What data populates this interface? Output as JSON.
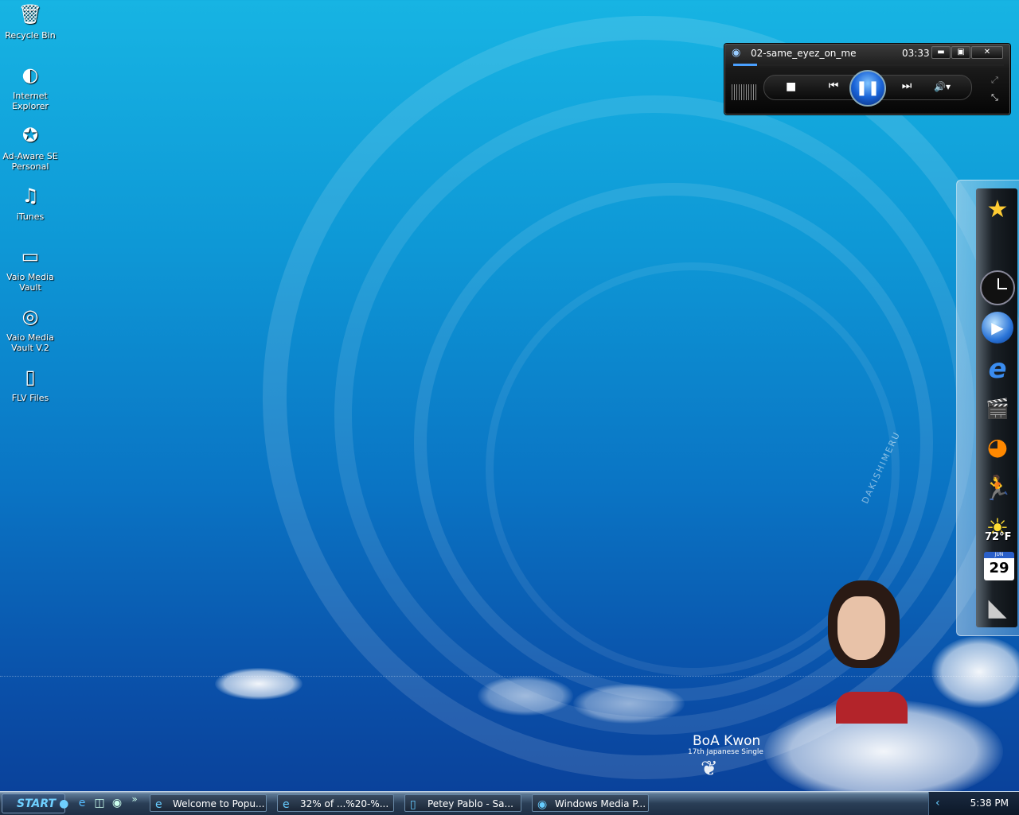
{
  "desktop_icons": [
    {
      "label": "Recycle Bin",
      "icon": "recycle-bin-icon",
      "glyph": "🗑"
    },
    {
      "label": "Internet\nExplorer",
      "icon": "internet-explorer-icon",
      "glyph": "◐"
    },
    {
      "label": "Ad-Aware SE\nPersonal",
      "icon": "ad-aware-icon",
      "glyph": "✪"
    },
    {
      "label": "iTunes",
      "icon": "itunes-icon",
      "glyph": "♫"
    },
    {
      "label": "Vaio Media\nVault",
      "icon": "vaio-media-vault-icon",
      "glyph": "▭"
    },
    {
      "label": "Vaio Media\nVault V.2",
      "icon": "vaio-media-vault-v2-icon",
      "glyph": "◎"
    },
    {
      "label": "FLV Files",
      "icon": "flv-files-icon",
      "glyph": "▯"
    }
  ],
  "media_player": {
    "track": "02-same_eyez_on_me",
    "time": "03:33",
    "minimize": "▬",
    "restore": "▣",
    "close": "✕",
    "stop": "■",
    "prev": "⏮",
    "pause": "❚❚",
    "next": "⏭",
    "volume": "🔊▾",
    "expand": "⤢",
    "shrink": "⤡"
  },
  "wallpaper": {
    "name": "BoA Kwon",
    "subtitle": "17th Japanese Single",
    "vertical_text": "DAKISHIMERU"
  },
  "dock": {
    "weather": "72°F",
    "calendar_month": "JUN",
    "calendar_day": "29"
  },
  "taskbar": {
    "start_label": "START",
    "quick_launch_more": "»",
    "buttons": [
      {
        "label": "Welcome to Popu...",
        "icon": "ie-icon"
      },
      {
        "label": "32% of ...%20-%...",
        "icon": "ie-download-icon"
      },
      {
        "label": "Petey Pablo - Sa...",
        "icon": "folder-icon"
      },
      {
        "label": "Windows Media P...",
        "icon": "media-player-icon"
      }
    ],
    "clock": "5:38 PM",
    "tray_chevron": "‹"
  }
}
